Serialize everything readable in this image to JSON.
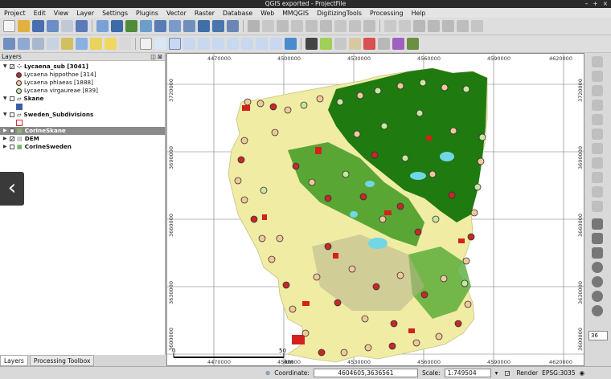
{
  "window": {
    "title": "QGIS exported - ProjectFile",
    "controls": [
      "–",
      "+",
      "×"
    ]
  },
  "menu": [
    "Project",
    "Edit",
    "View",
    "Layer",
    "Settings",
    "Plugins",
    "Vector",
    "Raster",
    "Database",
    "Web",
    "MMQGIS",
    "DigitizingTools",
    "Processing",
    "Help"
  ],
  "layers_panel": {
    "title": "Layers",
    "items": [
      {
        "name": "Lycaena_sub [3041]",
        "checked": "✓"
      },
      {
        "name": "Lycaena hippothoe [314]",
        "color": "#c62828"
      },
      {
        "name": "Lycaena phlaeas [1888]",
        "color": "#f2c89a"
      },
      {
        "name": "Lycaena virgaureae [839]",
        "color": "#c7e6a0"
      },
      {
        "name": "Skane",
        "checked": ""
      },
      {
        "name": "Sweden_Subdivisions",
        "checked": ""
      },
      {
        "name": "CorineSkane",
        "checked": "✓"
      },
      {
        "name": "DEM",
        "checked": "✓"
      },
      {
        "name": "CorineSweden",
        "checked": ""
      }
    ]
  },
  "tabs": [
    "Layers",
    "Processing Toolbox"
  ],
  "map": {
    "x_ticks": [
      "4470000",
      "4500000",
      "4530000",
      "4560000",
      "4590000",
      "4620000"
    ],
    "y_ticks": [
      "3720000",
      "3690000",
      "3660000",
      "3630000",
      "3600000"
    ],
    "scalebar": {
      "start": "0",
      "end": "50",
      "unit": "km"
    }
  },
  "status": {
    "coordinate_label": "Coordinate:",
    "coordinate": "4604605,3636561",
    "scale_label": "Scale:",
    "scale": "1:749504",
    "render_label": "Render",
    "crs": "EPSG:3035"
  },
  "right_toolbar": {
    "rotation": "36"
  },
  "nav_arrow": "‹",
  "colors": {
    "agri": "#f0eca4",
    "forest": "#1f7a10",
    "urban": "#d6201d",
    "water": "#6fd7e8"
  }
}
